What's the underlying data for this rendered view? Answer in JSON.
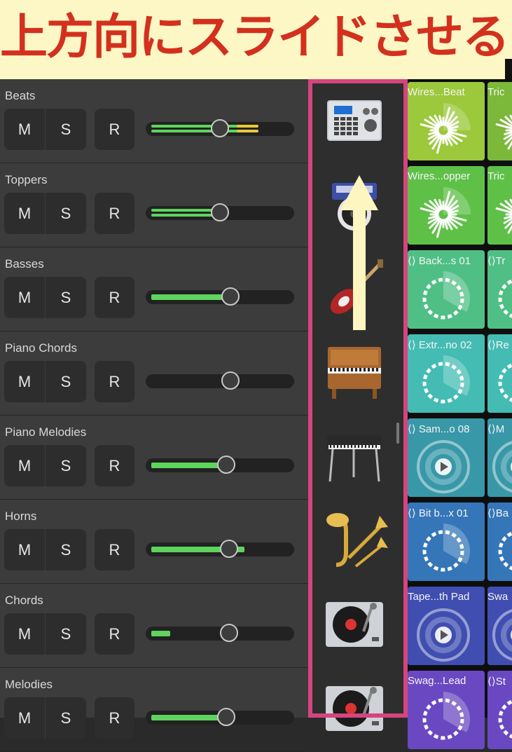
{
  "banner": {
    "text": "上方向にスライドさせる"
  },
  "tracks": [
    {
      "name": "Beats",
      "mute": "M",
      "solo": "S",
      "record": "R",
      "volume": 0.5,
      "level": 0.78
    },
    {
      "name": "Toppers",
      "mute": "M",
      "solo": "S",
      "record": "R",
      "volume": 0.5,
      "level": 0.49
    },
    {
      "name": "Basses",
      "mute": "M",
      "solo": "S",
      "record": "R",
      "volume": 0.58,
      "level": 0.56
    },
    {
      "name": "Piano Chords",
      "mute": "M",
      "solo": "S",
      "record": "R",
      "volume": 0.58,
      "level": 0.0
    },
    {
      "name": "Piano Melodies",
      "mute": "M",
      "solo": "S",
      "record": "R",
      "volume": 0.55,
      "level": 0.55
    },
    {
      "name": "Horns",
      "mute": "M",
      "solo": "S",
      "record": "R",
      "volume": 0.57,
      "level": 0.68
    },
    {
      "name": "Chords",
      "mute": "M",
      "solo": "S",
      "record": "R",
      "volume": 0.57,
      "level": 0.14
    },
    {
      "name": "Melodies",
      "mute": "M",
      "solo": "S",
      "record": "R",
      "volume": 0.55,
      "level": 0.55
    }
  ],
  "instruments": [
    {
      "icon": "drum-machine-icon"
    },
    {
      "icon": "beat-boombox-icon"
    },
    {
      "icon": "bass-guitar-icon"
    },
    {
      "icon": "upright-piano-icon"
    },
    {
      "icon": "electric-piano-icon"
    },
    {
      "icon": "horns-icon"
    },
    {
      "icon": "turntable-icon"
    },
    {
      "icon": "turntable-icon"
    }
  ],
  "cells": [
    {
      "label": "Wires...Beat",
      "label2": "Tric",
      "color": "#9cc83b",
      "color2": "#7cb83a",
      "viz": "burst"
    },
    {
      "label": "Wires...opper",
      "label2": "Tric",
      "color": "#5fc048",
      "color2": "#5fc048",
      "viz": "burst"
    },
    {
      "label": "Back...s 01",
      "label2": "Tr",
      "color": "#4fbf86",
      "color2": "#4fbf86",
      "viz": "ring",
      "loop": true
    },
    {
      "label": "Extr...no 02",
      "label2": "Re",
      "color": "#44bcb4",
      "color2": "#44bcb4",
      "viz": "ring",
      "loop": true
    },
    {
      "label": "Sam...o 08",
      "label2": "M",
      "color": "#3898a8",
      "color2": "#3898a8",
      "viz": "play",
      "loop": true
    },
    {
      "label": "Bit b...x 01",
      "label2": "Ba",
      "color": "#3576b8",
      "color2": "#3576b8",
      "viz": "ring",
      "loop": true
    },
    {
      "label": "Tape...th Pad",
      "label2": "Swa",
      "color": "#3f4eb0",
      "color2": "#3f4eb0",
      "viz": "play"
    },
    {
      "label": "Swag...Lead",
      "label2": "St",
      "color": "#6a48c2",
      "color2": "#6a48c2",
      "viz": "ring",
      "loop2": true
    }
  ]
}
